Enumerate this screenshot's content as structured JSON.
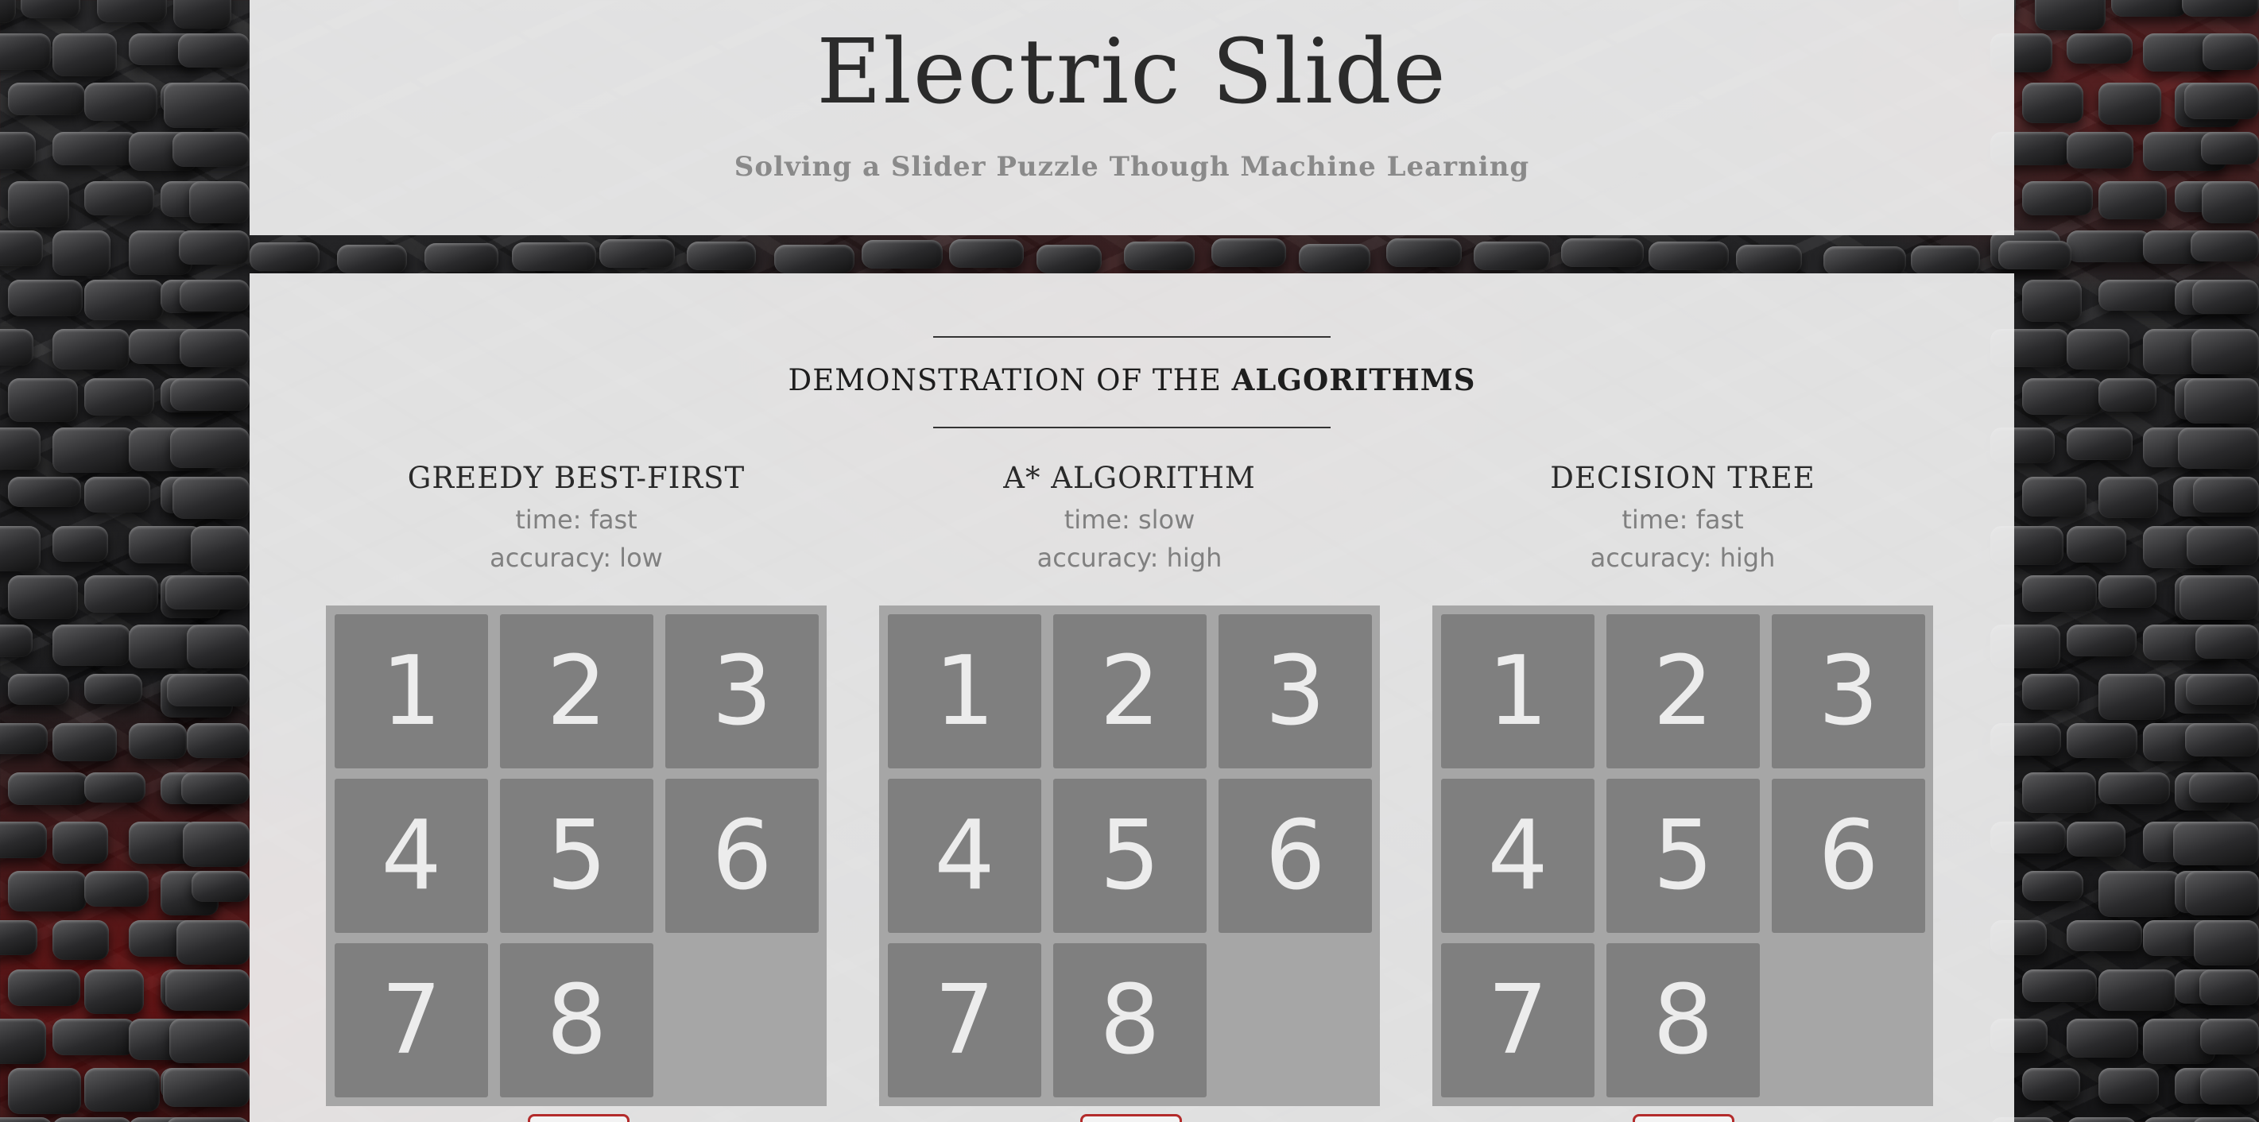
{
  "header": {
    "title": "Electric Slide",
    "subtitle": "Solving a Slider Puzzle Though Machine Learning"
  },
  "section": {
    "heading_prefix": "DEMONSTRATION OF THE ",
    "heading_emphasis": "ALGORITHMS"
  },
  "algorithms": [
    {
      "name": "GREEDY BEST-FIRST",
      "time": "time: fast",
      "accuracy": "accuracy: low",
      "tiles": [
        "1",
        "2",
        "3",
        "4",
        "5",
        "6",
        "7",
        "8"
      ]
    },
    {
      "name": "A* ALGORITHM",
      "time": "time: slow",
      "accuracy": "accuracy: high",
      "tiles": [
        "1",
        "2",
        "3",
        "4",
        "5",
        "6",
        "7",
        "8"
      ]
    },
    {
      "name": "DECISION TREE",
      "time": "time: fast",
      "accuracy": "accuracy: high",
      "tiles": [
        "1",
        "2",
        "3",
        "4",
        "5",
        "6",
        "7",
        "8"
      ]
    }
  ],
  "colors": {
    "tile": "#7f7f7f",
    "board": "#a6a6a6",
    "accent": "#b32b2b"
  }
}
